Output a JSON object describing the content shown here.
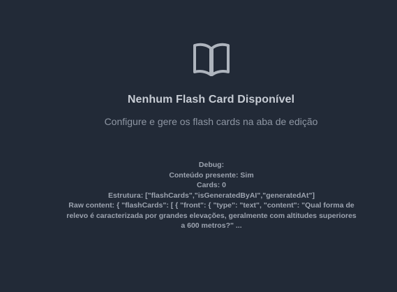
{
  "empty_state": {
    "icon": "book-open-icon",
    "title": "Nenhum Flash Card Disponível",
    "subtitle": "Configure e gere os flash cards na aba de edição"
  },
  "debug": {
    "heading": "Debug:",
    "content_present": "Conteúdo presente: Sim",
    "cards": "Cards: 0",
    "structure": "Estrutura: [\"flashCards\",\"isGeneratedByAI\",\"generatedAt\"]",
    "raw_content": "Raw content: { \"flashCards\": [ { \"front\": { \"type\": \"text\", \"content\": \"Qual forma de relevo é caracterizada por grandes elevações, geralmente com altitudes superiores a 600 metros?\" ..."
  },
  "colors": {
    "background": "#222a37",
    "title": "#c7ccd4",
    "subtitle": "#8e96a3",
    "debug_text": "#9ca3af",
    "icon": "#aeb4bd"
  }
}
